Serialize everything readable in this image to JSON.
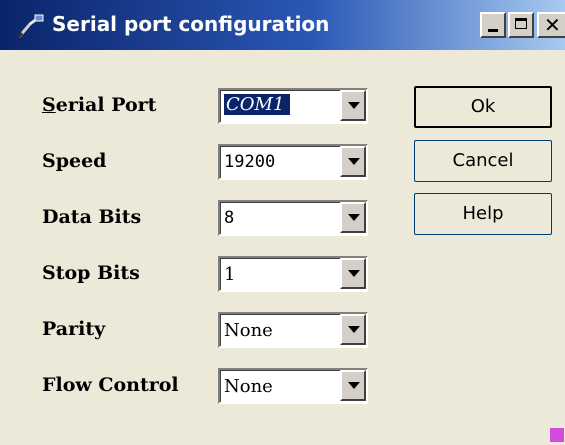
{
  "window": {
    "title": "Serial port configuration",
    "controls": {
      "minimize": "minimize",
      "maximize": "maximize",
      "close": "close"
    }
  },
  "fields": [
    {
      "label_accel": "S",
      "label_rest": "erial Port",
      "value": "COM1",
      "selected": true
    },
    {
      "label_accel": "",
      "label_rest": "Speed",
      "value": "19200"
    },
    {
      "label_accel": "",
      "label_rest": "Data Bits",
      "value": "8"
    },
    {
      "label_accel": "",
      "label_rest": "Stop Bits",
      "value": "1"
    },
    {
      "label_accel": "",
      "label_rest": "Parity",
      "value": "None"
    },
    {
      "label_accel": "",
      "label_rest": "Flow Control",
      "value": "None"
    }
  ],
  "buttons": {
    "ok": "Ok",
    "cancel": "Cancel",
    "help": "Help"
  },
  "colors": {
    "titlebar_start": "#0a246a",
    "titlebar_end": "#a6caf0",
    "face": "#ece9d8",
    "selection": "#0a246a"
  }
}
